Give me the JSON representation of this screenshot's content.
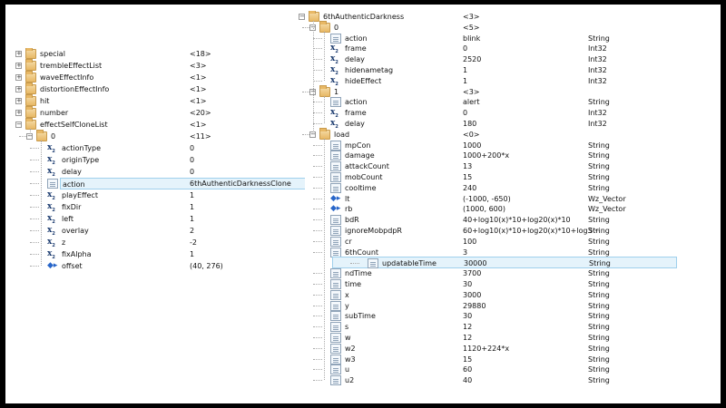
{
  "left_tree": [
    {
      "depth": 0,
      "expand": "+",
      "icon": "folder",
      "name": "special",
      "value": "<18>"
    },
    {
      "depth": 0,
      "expand": "+",
      "icon": "folder",
      "name": "trembleEffectList",
      "value": "<3>"
    },
    {
      "depth": 0,
      "expand": "+",
      "icon": "folder",
      "name": "waveEffectInfo",
      "value": "<1>"
    },
    {
      "depth": 0,
      "expand": "+",
      "icon": "folder",
      "name": "distortionEffectInfo",
      "value": "<1>"
    },
    {
      "depth": 0,
      "expand": "+",
      "icon": "folder",
      "name": "hit",
      "value": "<1>"
    },
    {
      "depth": 0,
      "expand": "+",
      "icon": "folder",
      "name": "number",
      "value": "<20>"
    },
    {
      "depth": 0,
      "expand": "-",
      "icon": "folder",
      "name": "effectSelfCloneList",
      "value": "<1>"
    },
    {
      "depth": 1,
      "expand": "-",
      "icon": "folder",
      "name": "0",
      "value": "<11>"
    },
    {
      "depth": 2,
      "expand": "",
      "icon": "int",
      "name": "actionType",
      "value": "0"
    },
    {
      "depth": 2,
      "expand": "",
      "icon": "int",
      "name": "originType",
      "value": "0"
    },
    {
      "depth": 2,
      "expand": "",
      "icon": "int",
      "name": "delay",
      "value": "0"
    },
    {
      "depth": 2,
      "expand": "",
      "icon": "string",
      "name": "action",
      "value": "6thAuthenticDarknessClone",
      "selected": true
    },
    {
      "depth": 2,
      "expand": "",
      "icon": "int",
      "name": "playEffect",
      "value": "1"
    },
    {
      "depth": 2,
      "expand": "",
      "icon": "int",
      "name": "fixDir",
      "value": "1"
    },
    {
      "depth": 2,
      "expand": "",
      "icon": "int",
      "name": "left",
      "value": "1"
    },
    {
      "depth": 2,
      "expand": "",
      "icon": "int",
      "name": "overlay",
      "value": "2"
    },
    {
      "depth": 2,
      "expand": "",
      "icon": "int",
      "name": "z",
      "value": "-2"
    },
    {
      "depth": 2,
      "expand": "",
      "icon": "int",
      "name": "fixAlpha",
      "value": "1"
    },
    {
      "depth": 2,
      "expand": "",
      "icon": "vector",
      "name": "offset",
      "value": "(40, 276)"
    }
  ],
  "right_tree": [
    {
      "depth": 0,
      "expand": "-",
      "icon": "folder",
      "name": "6thAuthenticDarkness",
      "value": "<3>",
      "type": ""
    },
    {
      "depth": 1,
      "expand": "-",
      "icon": "folder",
      "name": "0",
      "value": "<5>",
      "type": ""
    },
    {
      "depth": 2,
      "expand": "",
      "icon": "string",
      "name": "action",
      "value": "blink",
      "type": "String"
    },
    {
      "depth": 2,
      "expand": "",
      "icon": "int",
      "name": "frame",
      "value": "0",
      "type": "Int32"
    },
    {
      "depth": 2,
      "expand": "",
      "icon": "int",
      "name": "delay",
      "value": "2520",
      "type": "Int32"
    },
    {
      "depth": 2,
      "expand": "",
      "icon": "int",
      "name": "hidenametag",
      "value": "1",
      "type": "Int32"
    },
    {
      "depth": 2,
      "expand": "",
      "icon": "int",
      "name": "hideEffect",
      "value": "1",
      "type": "Int32"
    },
    {
      "depth": 1,
      "expand": "-",
      "icon": "folder",
      "name": "1",
      "value": "<3>",
      "type": ""
    },
    {
      "depth": 2,
      "expand": "",
      "icon": "string",
      "name": "action",
      "value": "alert",
      "type": "String"
    },
    {
      "depth": 2,
      "expand": "",
      "icon": "int",
      "name": "frame",
      "value": "0",
      "type": "Int32"
    },
    {
      "depth": 2,
      "expand": "",
      "icon": "int",
      "name": "delay",
      "value": "180",
      "type": "Int32"
    },
    {
      "depth": 1,
      "expand": "-",
      "icon": "folder",
      "name": "load",
      "value": "<0>",
      "type": ""
    },
    {
      "depth": 2,
      "expand": "",
      "icon": "string",
      "name": "mpCon",
      "value": "1000",
      "type": "String"
    },
    {
      "depth": 2,
      "expand": "",
      "icon": "string",
      "name": "damage",
      "value": "1000+200*x",
      "type": "String"
    },
    {
      "depth": 2,
      "expand": "",
      "icon": "string",
      "name": "attackCount",
      "value": "13",
      "type": "String"
    },
    {
      "depth": 2,
      "expand": "",
      "icon": "string",
      "name": "mobCount",
      "value": "15",
      "type": "String"
    },
    {
      "depth": 2,
      "expand": "",
      "icon": "string",
      "name": "cooltime",
      "value": "240",
      "type": "String"
    },
    {
      "depth": 2,
      "expand": "",
      "icon": "vector",
      "name": "lt",
      "value": "(-1000, -650)",
      "type": "Wz_Vector"
    },
    {
      "depth": 2,
      "expand": "",
      "icon": "vector",
      "name": "rb",
      "value": "(1000, 600)",
      "type": "Wz_Vector"
    },
    {
      "depth": 2,
      "expand": "",
      "icon": "string",
      "name": "bdR",
      "value": "40+log10(x)*10+log20(x)*10",
      "type": "String"
    },
    {
      "depth": 2,
      "expand": "",
      "icon": "string",
      "name": "ignoreMobpdpR",
      "value": "60+log10(x)*10+log20(x)*10+log3···",
      "type": "String"
    },
    {
      "depth": 2,
      "expand": "",
      "icon": "string",
      "name": "cr",
      "value": "100",
      "type": "String"
    },
    {
      "depth": 2,
      "expand": "",
      "icon": "string",
      "name": "6thCount",
      "value": "3",
      "type": "String"
    },
    {
      "depth": 2,
      "expand": "",
      "icon": "string",
      "name": "updatableTime",
      "value": "30000",
      "type": "String",
      "highlight": true
    },
    {
      "depth": 2,
      "expand": "",
      "icon": "string",
      "name": "ndTime",
      "value": "3700",
      "type": "String"
    },
    {
      "depth": 2,
      "expand": "",
      "icon": "string",
      "name": "time",
      "value": "30",
      "type": "String"
    },
    {
      "depth": 2,
      "expand": "",
      "icon": "string",
      "name": "x",
      "value": "3000",
      "type": "String"
    },
    {
      "depth": 2,
      "expand": "",
      "icon": "string",
      "name": "y",
      "value": "29880",
      "type": "String"
    },
    {
      "depth": 2,
      "expand": "",
      "icon": "string",
      "name": "subTime",
      "value": "30",
      "type": "String"
    },
    {
      "depth": 2,
      "expand": "",
      "icon": "string",
      "name": "s",
      "value": "12",
      "type": "String"
    },
    {
      "depth": 2,
      "expand": "",
      "icon": "string",
      "name": "w",
      "value": "12",
      "type": "String"
    },
    {
      "depth": 2,
      "expand": "",
      "icon": "string",
      "name": "w2",
      "value": "1120+224*x",
      "type": "String"
    },
    {
      "depth": 2,
      "expand": "",
      "icon": "string",
      "name": "w3",
      "value": "15",
      "type": "String"
    },
    {
      "depth": 2,
      "expand": "",
      "icon": "string",
      "name": "u",
      "value": "60",
      "type": "String"
    },
    {
      "depth": 2,
      "expand": "",
      "icon": "string",
      "name": "u2",
      "value": "40",
      "type": "String"
    }
  ]
}
